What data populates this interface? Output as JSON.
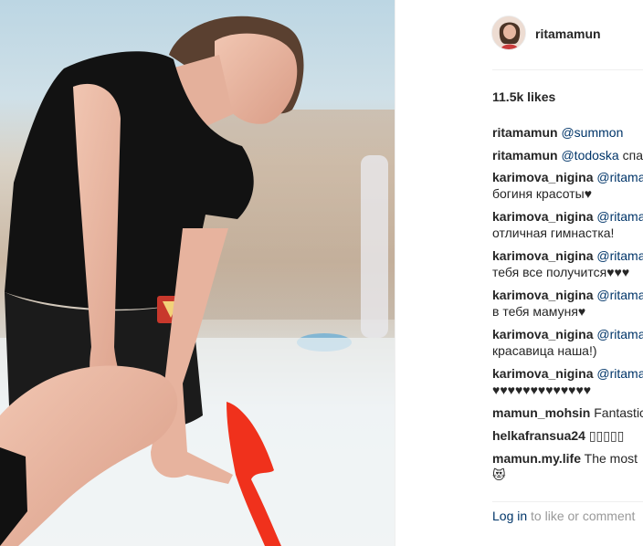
{
  "post": {
    "username": "ritamamun",
    "likes": "11.5k likes"
  },
  "comments": [
    {
      "user": "ritamamun",
      "mention": "@summon",
      "text": "",
      "text2": ""
    },
    {
      "user": "ritamamun",
      "mention": "@todoska",
      "text": " спа",
      "text2": ""
    },
    {
      "user": "karimova_nigina",
      "mention": "@ritama",
      "text": "",
      "text2": "богиня красоты♥"
    },
    {
      "user": "karimova_nigina",
      "mention": "@ritama",
      "text": "",
      "text2": "отличная гимнастка!"
    },
    {
      "user": "karimova_nigina",
      "mention": "@ritama",
      "text": "",
      "text2": "тебя все получится♥♥♥"
    },
    {
      "user": "karimova_nigina",
      "mention": "@ritama",
      "text": "",
      "text2": "в тебя мамуня♥"
    },
    {
      "user": "karimova_nigina",
      "mention": "@ritama",
      "text": "",
      "text2": "красавица наша!)"
    },
    {
      "user": "karimova_nigina",
      "mention": "@ritama",
      "text": "",
      "text2": "♥♥♥♥♥♥♥♥♥♥♥♥♥"
    },
    {
      "user": "mamun_mohsin",
      "mention": "",
      "text": " Fantastic",
      "text2": ""
    },
    {
      "user": "helkafransua24",
      "mention": "",
      "text": " ▯▯▯▯▯",
      "text2": ""
    },
    {
      "user": "mamun.my.life",
      "mention": "",
      "text": " The most",
      "text2": "😻"
    }
  ],
  "footer": {
    "login_label": "Log in",
    "login_suffix": " to like or comment"
  },
  "colors": {
    "link": "#003569",
    "text": "#262626",
    "muted": "#999999",
    "shirt": "#111111",
    "ribbon": "#f0311c"
  },
  "icons": {
    "avatar": "profile-avatar",
    "emblem": "russian-emblem-patch"
  }
}
